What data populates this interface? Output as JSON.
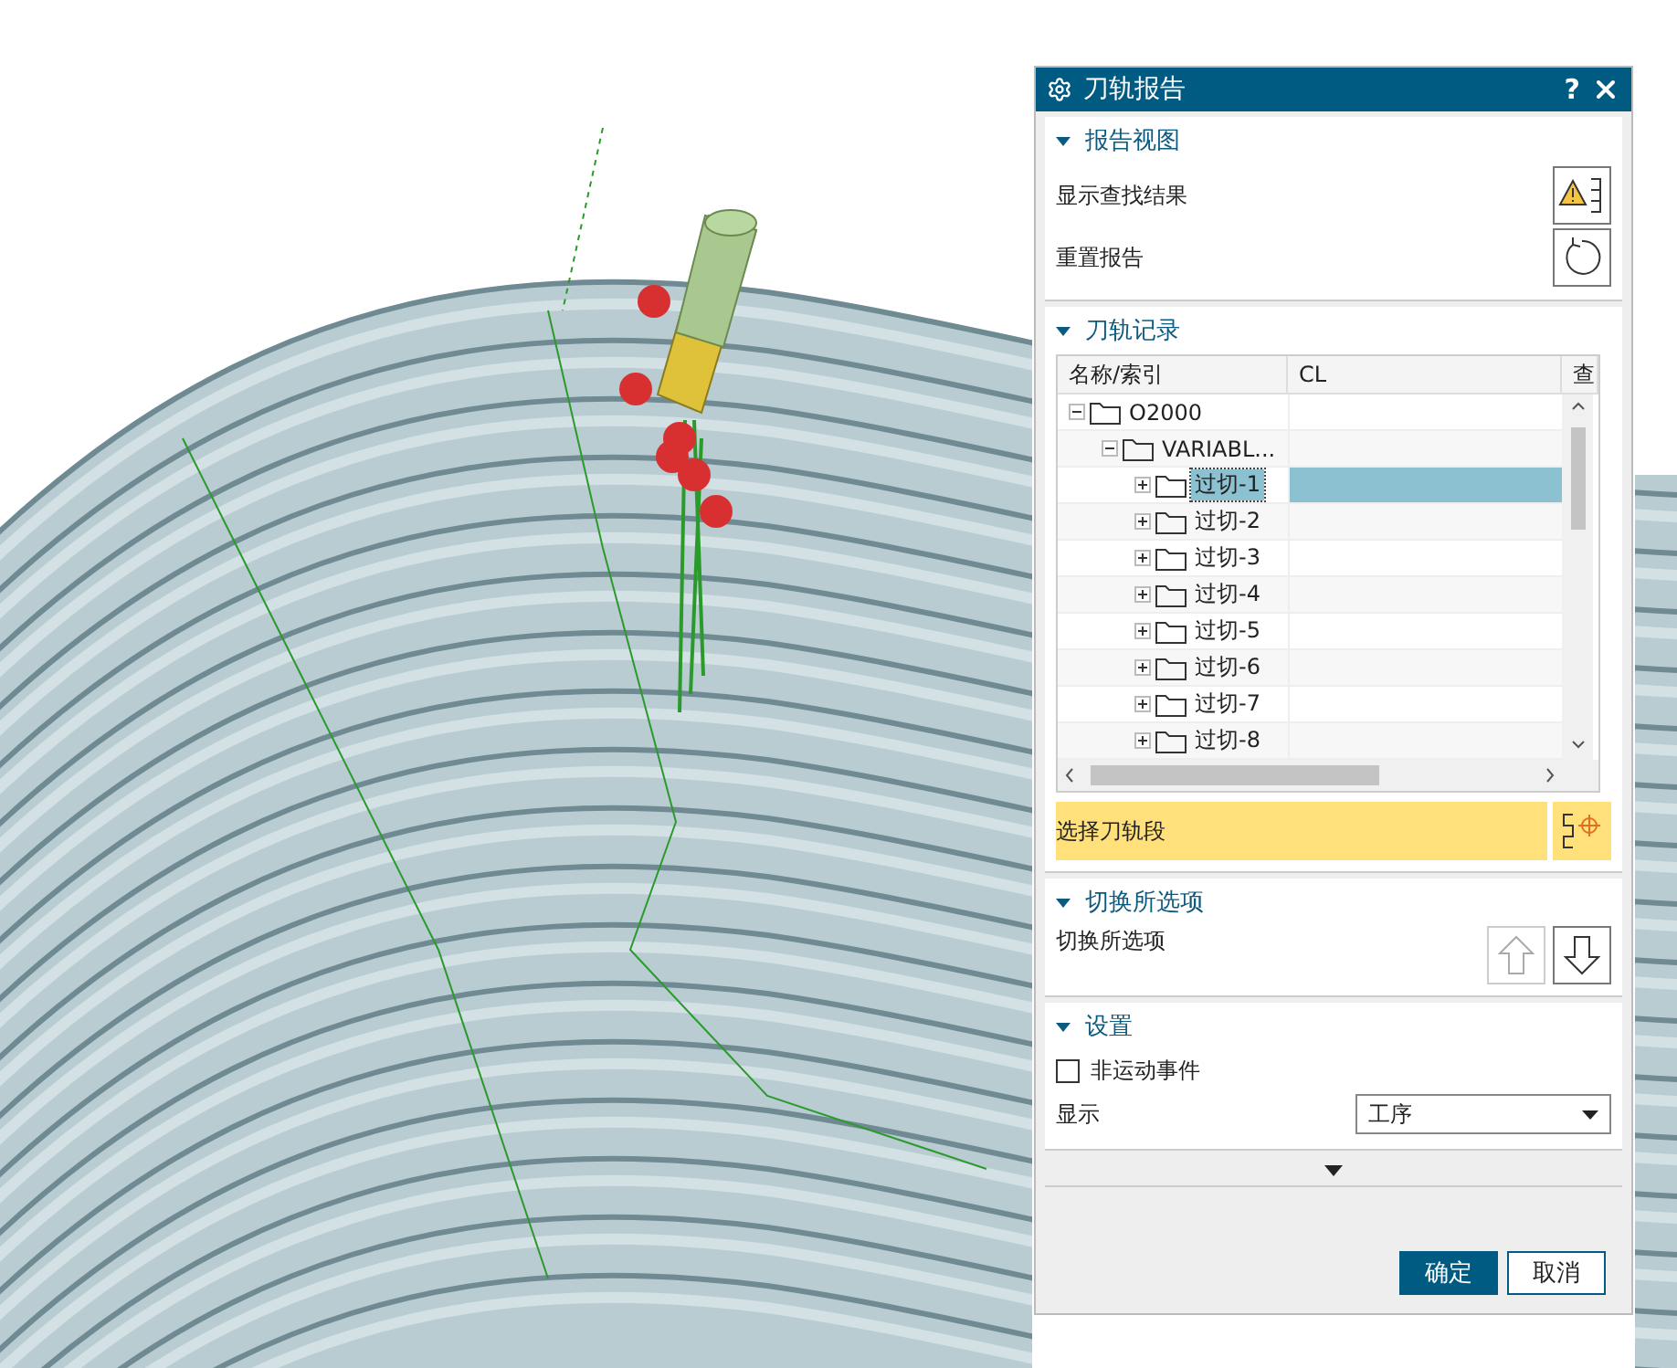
{
  "window": {
    "title": "刀轨报告",
    "help": "?"
  },
  "report_view": {
    "title": "报告视图",
    "expanded": true,
    "rows": [
      {
        "label": "显示查找结果"
      },
      {
        "label": "重置报告"
      }
    ]
  },
  "toolpath_record": {
    "title": "刀轨记录",
    "expanded": true,
    "columns": [
      "名称/索引",
      "CL",
      "查"
    ],
    "tree": [
      {
        "label": "O2000",
        "expanded": true,
        "selected": false,
        "children": [
          {
            "label": "VARIABL...",
            "expanded": true,
            "selected": false,
            "children": [
              {
                "label": "过切-1",
                "expanded": false,
                "selected": true
              },
              {
                "label": "过切-2",
                "expanded": false,
                "selected": false
              },
              {
                "label": "过切-3",
                "expanded": false,
                "selected": false
              },
              {
                "label": "过切-4",
                "expanded": false,
                "selected": false
              },
              {
                "label": "过切-5",
                "expanded": false,
                "selected": false
              },
              {
                "label": "过切-6",
                "expanded": false,
                "selected": false
              },
              {
                "label": "过切-7",
                "expanded": false,
                "selected": false
              },
              {
                "label": "过切-8",
                "expanded": false,
                "selected": false
              }
            ]
          }
        ]
      }
    ],
    "select_label": "选择刀轨段"
  },
  "toggle_selection": {
    "title": "切换所选项",
    "expanded": true,
    "label": "切换所选项"
  },
  "settings": {
    "title": "设置",
    "expanded": true,
    "checkbox": {
      "label": "非运动事件",
      "checked": false
    },
    "display": {
      "label": "显示",
      "value": "工序"
    }
  },
  "buttons": [
    {
      "label": "确定",
      "primary": true
    },
    {
      "label": "取消",
      "primary": false
    }
  ]
}
